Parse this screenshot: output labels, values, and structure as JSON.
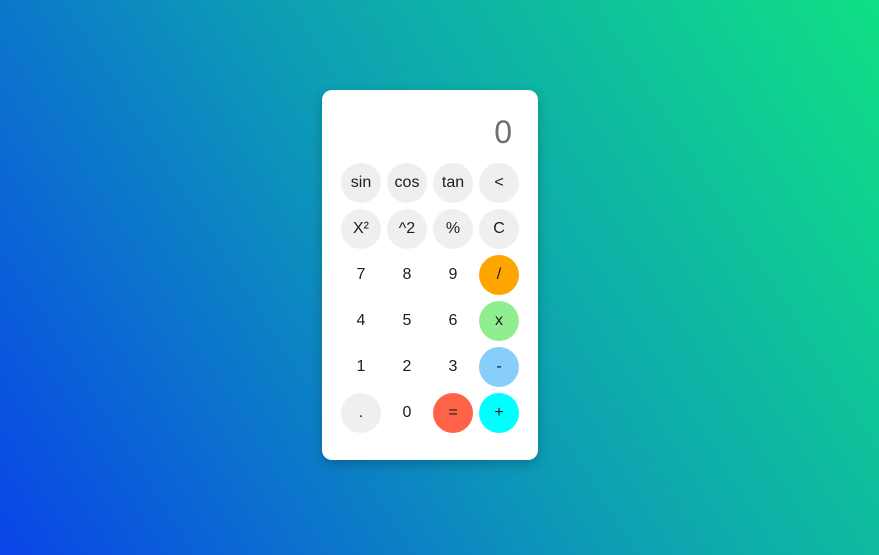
{
  "theme": {
    "background_gradient": [
      "#0a44e8",
      "#10e085"
    ],
    "card_color": "#ffffff",
    "display_color": "#6f6f6f",
    "function_button_color": "#efefef",
    "divide_color": "#ffa500",
    "multiply_color": "#90ee90",
    "minus_color": "#87cefa",
    "plus_color": "#00ffff",
    "equals_color": "#ff6347"
  },
  "display": {
    "value": "0"
  },
  "buttons": [
    {
      "id": "sin",
      "label": "sin",
      "style": "gray"
    },
    {
      "id": "cos",
      "label": "cos",
      "style": "gray"
    },
    {
      "id": "tan",
      "label": "tan",
      "style": "gray"
    },
    {
      "id": "backspace",
      "label": "<",
      "style": "gray"
    },
    {
      "id": "square",
      "label": "X²",
      "style": "gray"
    },
    {
      "id": "power",
      "label": "^2",
      "style": "gray"
    },
    {
      "id": "percent",
      "label": "%",
      "style": "gray"
    },
    {
      "id": "clear",
      "label": "C",
      "style": "gray"
    },
    {
      "id": "7",
      "label": "7",
      "style": "plain"
    },
    {
      "id": "8",
      "label": "8",
      "style": "plain"
    },
    {
      "id": "9",
      "label": "9",
      "style": "plain"
    },
    {
      "id": "divide",
      "label": "/",
      "style": "divide"
    },
    {
      "id": "4",
      "label": "4",
      "style": "plain"
    },
    {
      "id": "5",
      "label": "5",
      "style": "plain"
    },
    {
      "id": "6",
      "label": "6",
      "style": "plain"
    },
    {
      "id": "multiply",
      "label": "x",
      "style": "multiply"
    },
    {
      "id": "1",
      "label": "1",
      "style": "plain"
    },
    {
      "id": "2",
      "label": "2",
      "style": "plain"
    },
    {
      "id": "3",
      "label": "3",
      "style": "plain"
    },
    {
      "id": "minus",
      "label": "-",
      "style": "minus"
    },
    {
      "id": "decimal",
      "label": ".",
      "style": "gray"
    },
    {
      "id": "0",
      "label": "0",
      "style": "plain"
    },
    {
      "id": "equals",
      "label": "=",
      "style": "equals"
    },
    {
      "id": "plus",
      "label": "+",
      "style": "plus"
    }
  ]
}
